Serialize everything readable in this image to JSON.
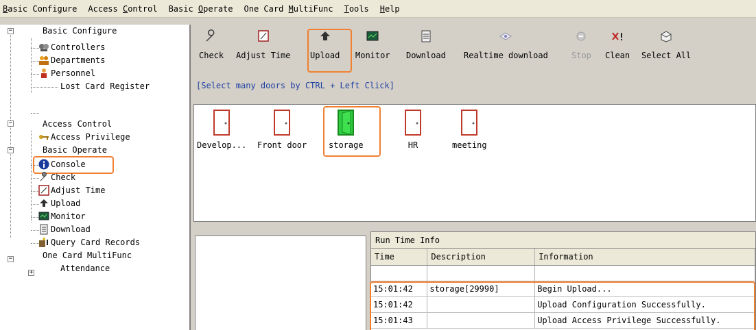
{
  "menu": [
    {
      "pre": "",
      "key": "B",
      "post": "asic Configure"
    },
    {
      "pre": "Access ",
      "key": "C",
      "post": "ontrol"
    },
    {
      "pre": "Basic ",
      "key": "O",
      "post": "perate"
    },
    {
      "pre": "One Card ",
      "key": "M",
      "post": "ultiFunc"
    },
    {
      "pre": "",
      "key": "T",
      "post": "ools"
    },
    {
      "pre": "",
      "key": "H",
      "post": "elp"
    }
  ],
  "tree": {
    "basic_configure": "Basic Configure",
    "controllers": "Controllers",
    "departments": "Departments",
    "personnel": "Personnel",
    "lost_card": "Lost Card Register",
    "access_control": "Access Control",
    "access_privilege": "Access Privilege",
    "basic_operate": "Basic Operate",
    "console": "Console",
    "check": "Check",
    "adjust_time": "Adjust Time",
    "upload": "Upload",
    "monitor": "Monitor",
    "download": "Download",
    "query_card_records": "Query Card Records",
    "one_card": "One Card MultiFunc",
    "attendance": "Attendance"
  },
  "toolbar": {
    "check": "Check",
    "adjust_time": "Adjust Time",
    "upload": "Upload",
    "monitor": "Monitor",
    "download": "Download",
    "realtime_download": "Realtime download",
    "stop": "Stop",
    "clean": "Clean",
    "select_all": "Select All"
  },
  "hint": "[Select many doors by CTRL + Left Click]",
  "doors": {
    "d1": "Develop...",
    "d2": "Front door",
    "d3": "storage",
    "d4": "HR",
    "d5": "meeting"
  },
  "runinfo": {
    "title": "Run Time Info",
    "columns": {
      "time": "Time",
      "description": "Description",
      "information": "Information"
    },
    "rows": [
      {
        "time": "",
        "description": "",
        "information": ""
      },
      {
        "time": "15:01:42",
        "description": "storage[29990]",
        "information": "Begin Upload..."
      },
      {
        "time": "15:01:42",
        "description": "",
        "information": "Upload Configuration Successfully."
      },
      {
        "time": "15:01:43",
        "description": "",
        "information": "Upload Access Privilege Successfully."
      }
    ]
  },
  "colors": {
    "highlight": "#f08030",
    "door_normal": "#c0392b",
    "door_selected": "#2ecc40",
    "hint_text": "#2040a0"
  }
}
